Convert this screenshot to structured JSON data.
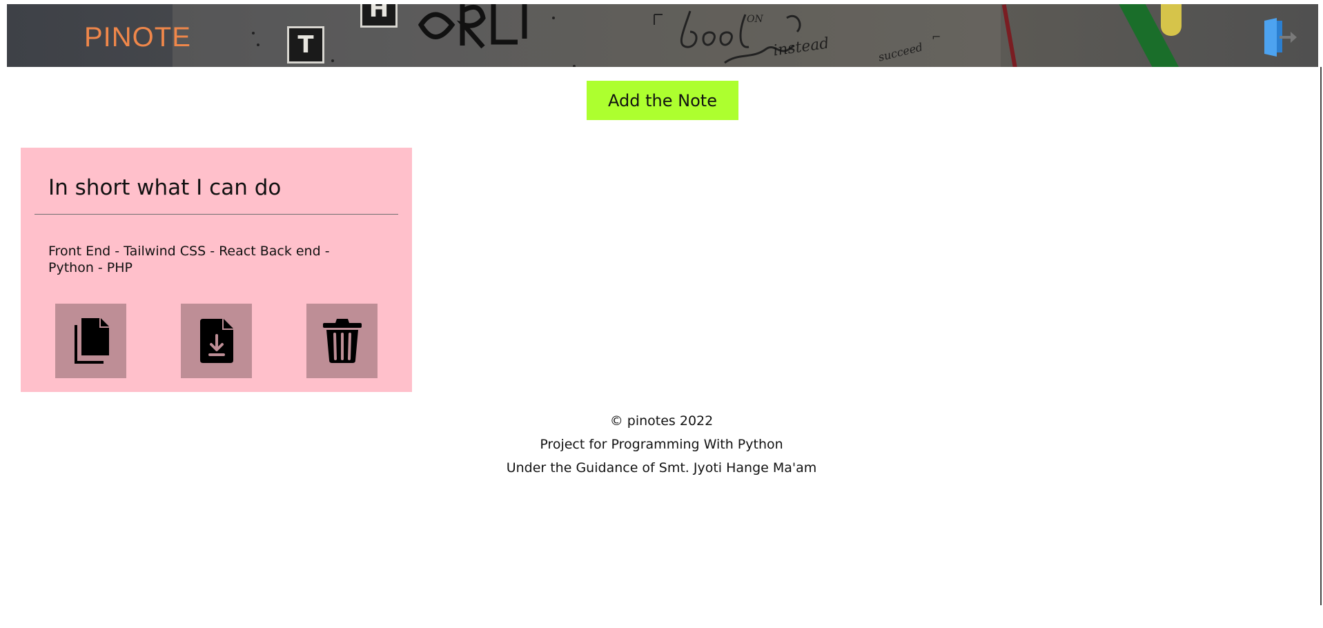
{
  "header": {
    "brand": "PINOTE",
    "background_icon": "notebook-photo",
    "logout_icon": "logout-door-icon"
  },
  "toolbar": {
    "add_note_label": "Add the Note"
  },
  "note": {
    "title": "In short what I can do",
    "body": "Front End - Tailwind CSS - React Back end - Python - PHP",
    "actions": [
      {
        "icon": "copy-icon"
      },
      {
        "icon": "download-file-icon"
      },
      {
        "icon": "trash-icon"
      }
    ]
  },
  "footer": {
    "copyright": "© pinotes 2022",
    "project": "Project for Programming With Python",
    "guidance": "Under the Guidance of Smt. Jyoti Hange Ma'am"
  },
  "colors": {
    "brand": "#f0874a",
    "add_button": "#adff2f",
    "note_card": "#ffc0cb",
    "action_button": "#be8e96",
    "logout_icon": "#4da3f0"
  }
}
